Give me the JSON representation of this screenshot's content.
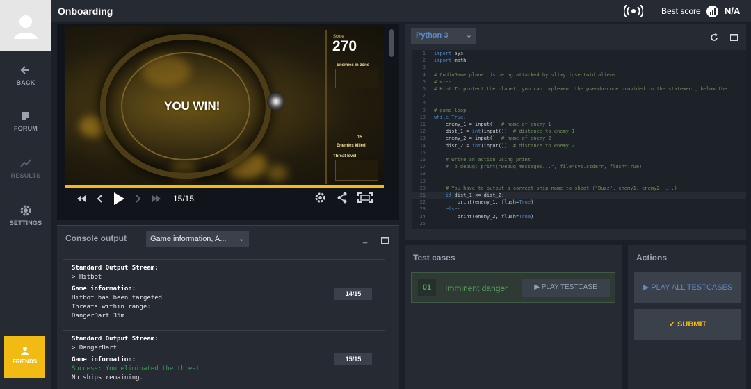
{
  "header": {
    "title": "Onboarding",
    "best_score_label": "Best score",
    "best_score_value": "N/A"
  },
  "sidebar": {
    "items": [
      {
        "label": "BACK",
        "icon": "arrow-left-icon"
      },
      {
        "label": "FORUM",
        "icon": "chat-icon"
      },
      {
        "label": "RESULTS",
        "icon": "chart-line-icon"
      },
      {
        "label": "SETTINGS",
        "icon": "gear-icon"
      }
    ],
    "friends_label": "FRIENDS"
  },
  "viewer": {
    "win_text": "YOU WIN!",
    "score_label": "Score",
    "score_value": "270",
    "enemies_in_zone": "Enemies in zone",
    "enemies_killed": "Enemies killed",
    "killed_count": "15",
    "threat_level": "Threat level",
    "frame_counter": "15/15",
    "progress": 1.0
  },
  "console": {
    "title": "Console output",
    "filter": "Game information, A...",
    "logs": [
      {
        "stream_label": "Standard Output Stream:",
        "stream_value": "> Hitbot",
        "info_label": "Game information:",
        "info_lines": [
          "Hitbot has been targeted",
          "Threats within range:",
          "DangerDart 35m"
        ],
        "frame": "14/15"
      },
      {
        "stream_label": "Standard Output Stream:",
        "stream_value": "> DangerDart",
        "info_label": "Game information:",
        "success_line": "Success: You eliminated the threat",
        "info_line": "No ships remaining.",
        "frame": "15/15"
      }
    ]
  },
  "editor": {
    "language": "Python 3"
  },
  "tests": {
    "title": "Test cases",
    "items": [
      {
        "number": "01",
        "name": "Imminent danger",
        "play_label": "PLAY TESTCASE"
      }
    ]
  },
  "actions": {
    "title": "Actions",
    "play_all_label": "PLAY ALL TESTCASES",
    "submit_label": "SUBMIT"
  },
  "colors": {
    "accent": "#f2bb13",
    "success": "#5aa15f",
    "link": "#5e88c5",
    "panel": "#252a33"
  }
}
